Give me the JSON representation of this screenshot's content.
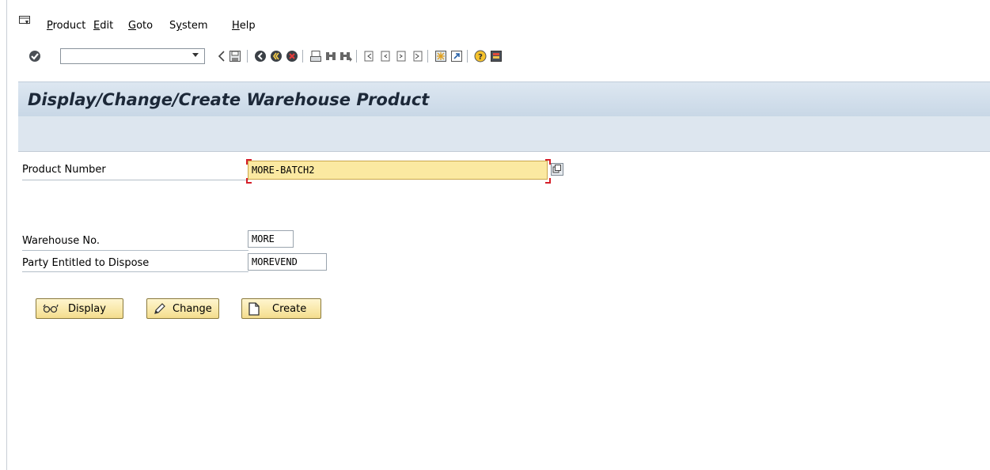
{
  "menu": {
    "items": [
      "Product",
      "Edit",
      "Goto",
      "System",
      "Help"
    ],
    "underline_chars": [
      "P",
      "E",
      "G",
      "y",
      "H"
    ]
  },
  "toolbar": {
    "command_field_value": "",
    "icons": [
      "enter-icon",
      "back-icon",
      "save-icon",
      "back-nav-icon",
      "exit-icon",
      "cancel-icon",
      "print-icon",
      "find-icon",
      "find-next-icon",
      "first-page-icon",
      "prev-page-icon",
      "next-page-icon",
      "last-page-icon",
      "new-session-icon",
      "shortcut-icon",
      "help-icon",
      "customize-layout-icon"
    ]
  },
  "title": "Display/Change/Create Warehouse Product",
  "form": {
    "product_number_label": "Product Number",
    "product_number_value": "MORE-BATCH2",
    "warehouse_no_label": "Warehouse No.",
    "warehouse_no_value": "MORE",
    "party_label": "Party Entitled to Dispose",
    "party_value": "MOREVEND"
  },
  "buttons": {
    "display": "Display",
    "change": "Change",
    "create": "Create"
  },
  "colors": {
    "active_field": "#fbe9a1",
    "title_band": "#dde7f1",
    "button_bg": "#f4dd8d"
  }
}
